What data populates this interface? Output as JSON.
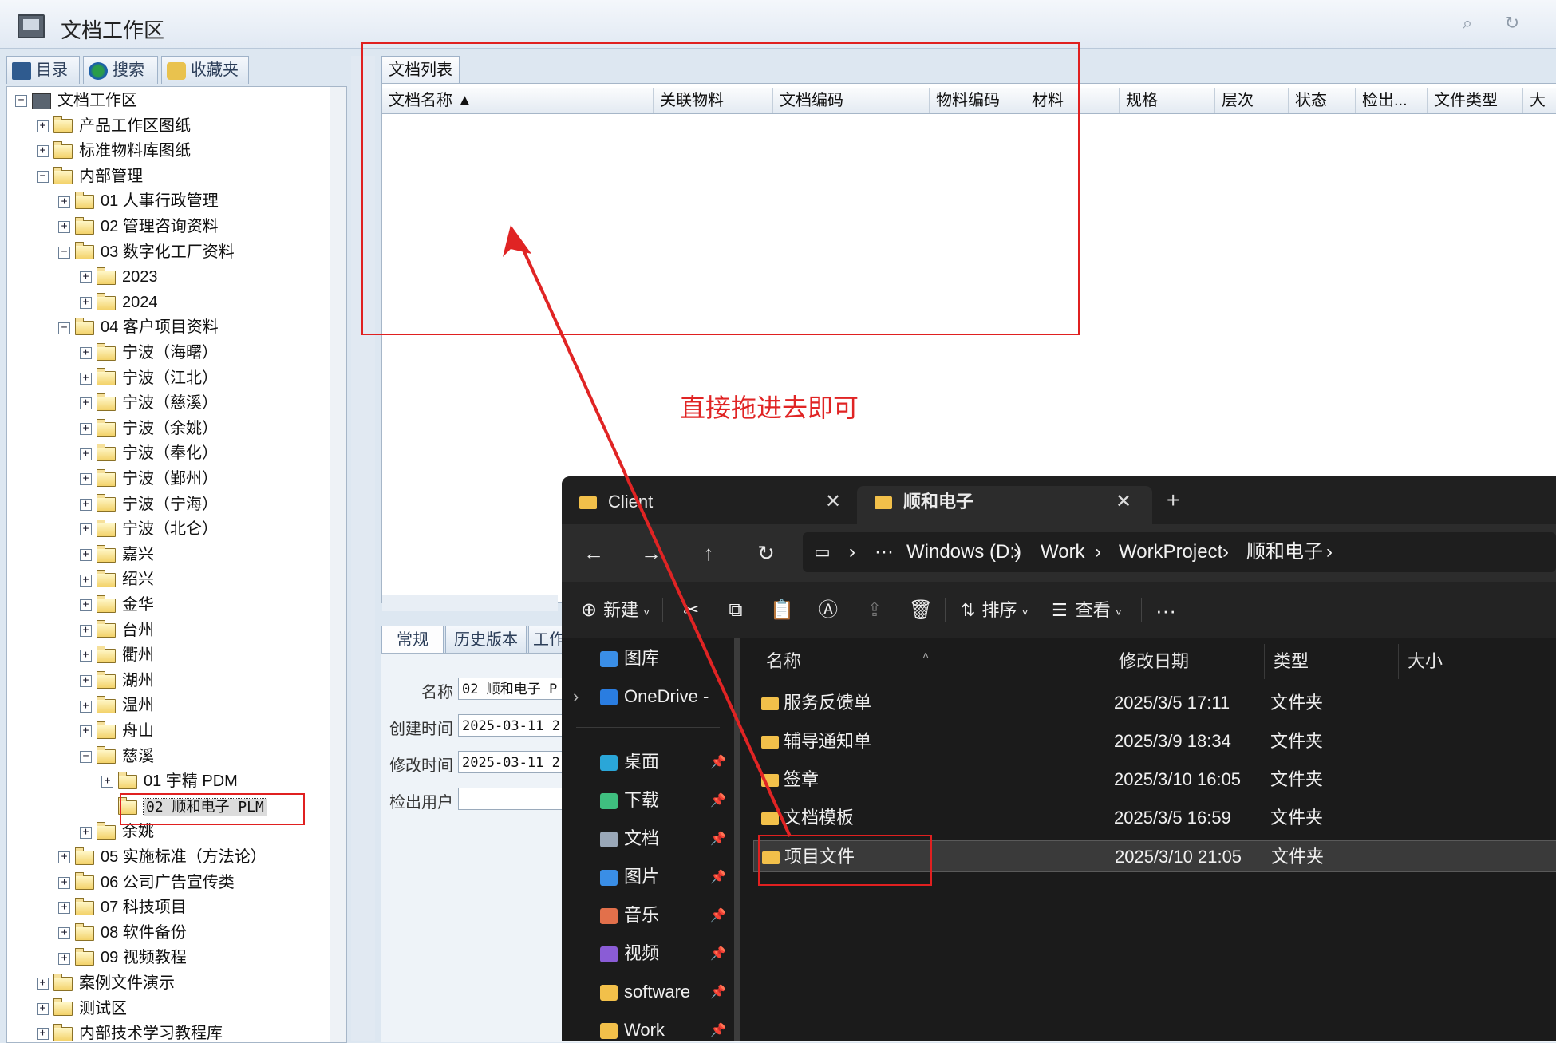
{
  "app": {
    "title": "文档工作区"
  },
  "left_tabs": [
    "目录",
    "搜索",
    "收藏夹"
  ],
  "tree": [
    {
      "label": "文档工作区",
      "indent": 0,
      "toggle": "−",
      "icon": "computer"
    },
    {
      "label": "产品工作区图纸",
      "indent": 1,
      "toggle": "+"
    },
    {
      "label": "标准物料库图纸",
      "indent": 1,
      "toggle": "+"
    },
    {
      "label": "内部管理",
      "indent": 1,
      "toggle": "−"
    },
    {
      "label": "01 人事行政管理",
      "indent": 2,
      "toggle": "+"
    },
    {
      "label": "02 管理咨询资料",
      "indent": 2,
      "toggle": "+"
    },
    {
      "label": "03 数字化工厂资料",
      "indent": 2,
      "toggle": "−"
    },
    {
      "label": "2023",
      "indent": 3,
      "toggle": "+"
    },
    {
      "label": "2024",
      "indent": 3,
      "toggle": "+"
    },
    {
      "label": "04 客户项目资料",
      "indent": 2,
      "toggle": "−"
    },
    {
      "label": "宁波（海曙）",
      "indent": 3,
      "toggle": "+"
    },
    {
      "label": "宁波（江北）",
      "indent": 3,
      "toggle": "+"
    },
    {
      "label": "宁波（慈溪）",
      "indent": 3,
      "toggle": "+"
    },
    {
      "label": "宁波（余姚）",
      "indent": 3,
      "toggle": "+"
    },
    {
      "label": "宁波（奉化）",
      "indent": 3,
      "toggle": "+"
    },
    {
      "label": "宁波（鄞州）",
      "indent": 3,
      "toggle": "+"
    },
    {
      "label": "宁波（宁海）",
      "indent": 3,
      "toggle": "+"
    },
    {
      "label": "宁波（北仑）",
      "indent": 3,
      "toggle": "+"
    },
    {
      "label": "嘉兴",
      "indent": 3,
      "toggle": "+"
    },
    {
      "label": "绍兴",
      "indent": 3,
      "toggle": "+"
    },
    {
      "label": "金华",
      "indent": 3,
      "toggle": "+"
    },
    {
      "label": "台州",
      "indent": 3,
      "toggle": "+"
    },
    {
      "label": "衢州",
      "indent": 3,
      "toggle": "+"
    },
    {
      "label": "湖州",
      "indent": 3,
      "toggle": "+"
    },
    {
      "label": "温州",
      "indent": 3,
      "toggle": "+"
    },
    {
      "label": "舟山",
      "indent": 3,
      "toggle": "+"
    },
    {
      "label": "慈溪",
      "indent": 3,
      "toggle": "−"
    },
    {
      "label": "01 宇精 PDM",
      "indent": 4,
      "toggle": "+"
    },
    {
      "label": "02 顺和电子 PLM",
      "indent": 4,
      "toggle": "",
      "selected": true
    },
    {
      "label": "余姚",
      "indent": 3,
      "toggle": "+"
    },
    {
      "label": "05 实施标准（方法论）",
      "indent": 2,
      "toggle": "+"
    },
    {
      "label": "06 公司广告宣传类",
      "indent": 2,
      "toggle": "+"
    },
    {
      "label": "07 科技项目",
      "indent": 2,
      "toggle": "+"
    },
    {
      "label": "08 软件备份",
      "indent": 2,
      "toggle": "+"
    },
    {
      "label": "09 视频教程",
      "indent": 2,
      "toggle": "+"
    },
    {
      "label": "案例文件演示",
      "indent": 1,
      "toggle": "+"
    },
    {
      "label": "测试区",
      "indent": 1,
      "toggle": "+"
    },
    {
      "label": "内部技术学习教程库",
      "indent": 1,
      "toggle": "+"
    }
  ],
  "doc_list": {
    "tab": "文档列表",
    "columns": [
      "文档名称",
      "关联物料",
      "文档编码",
      "物料编码",
      "材料",
      "规格",
      "层次",
      "状态",
      "检出...",
      "文件类型",
      "大"
    ]
  },
  "detail": {
    "tabs": [
      "常规",
      "历史版本",
      "工作"
    ],
    "fields": [
      {
        "label": "名称",
        "value": "02 顺和电子 P"
      },
      {
        "label": "创建时间",
        "value": "2025-03-11 2"
      },
      {
        "label": "修改时间",
        "value": "2025-03-11 2"
      },
      {
        "label": "检出用户",
        "value": ""
      }
    ]
  },
  "annotation": {
    "text": "直接拖进去即可",
    "color": "#e02424"
  },
  "explorer": {
    "tabs": [
      "Client",
      "顺和电子"
    ],
    "new_tab": "+",
    "breadcrumb": [
      "Windows (D:)",
      "Work",
      "WorkProject",
      "顺和电子"
    ],
    "more": "···",
    "commands": {
      "new": "新建",
      "sort": "排序",
      "view": "查看",
      "more": "···"
    },
    "sidebar": [
      {
        "label": "图库",
        "icon": "gallery-icon",
        "color": "#3a8ee6",
        "pinned": false
      },
      {
        "label": "OneDrive - ",
        "icon": "cloud-icon",
        "color": "#2a7de1",
        "pinned": false,
        "expand": true
      },
      {
        "label": "桌面",
        "icon": "desktop-icon",
        "color": "#2aa6d8",
        "pinned": true
      },
      {
        "label": "下载",
        "icon": "download-icon",
        "color": "#3fbf7f",
        "pinned": true
      },
      {
        "label": "文档",
        "icon": "document-icon",
        "color": "#9aa8b8",
        "pinned": true
      },
      {
        "label": "图片",
        "icon": "pictures-icon",
        "color": "#3a8ee6",
        "pinned": true
      },
      {
        "label": "音乐",
        "icon": "music-icon",
        "color": "#e2704b",
        "pinned": true
      },
      {
        "label": "视频",
        "icon": "video-icon",
        "color": "#8a5cd6",
        "pinned": true
      },
      {
        "label": "software",
        "icon": "folder-icon",
        "color": "#f2c04a",
        "pinned": true
      },
      {
        "label": "Work",
        "icon": "folder-icon",
        "color": "#f2c04a",
        "pinned": true
      }
    ],
    "columns": [
      "名称",
      "修改日期",
      "类型",
      "大小"
    ],
    "files": [
      {
        "name": "服务反馈单",
        "date": "2025/3/5 17:11",
        "type": "文件夹"
      },
      {
        "name": "辅导通知单",
        "date": "2025/3/9 18:34",
        "type": "文件夹"
      },
      {
        "name": "签章",
        "date": "2025/3/10 16:05",
        "type": "文件夹"
      },
      {
        "name": "文档模板",
        "date": "2025/3/5 16:59",
        "type": "文件夹"
      },
      {
        "name": "项目文件",
        "date": "2025/3/10 21:05",
        "type": "文件夹",
        "selected": true
      }
    ]
  }
}
